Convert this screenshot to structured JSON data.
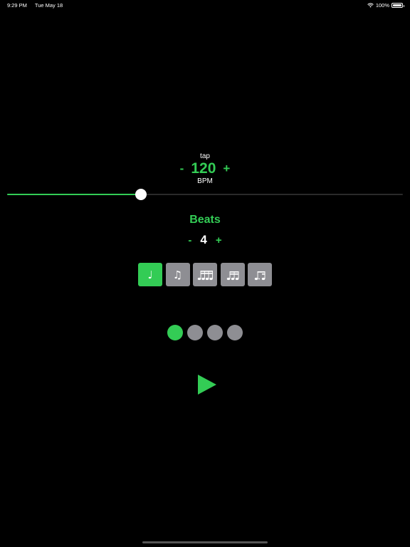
{
  "status_bar": {
    "time": "9:29 PM",
    "date": "Tue May 18",
    "battery": "100%"
  },
  "tempo": {
    "tap_label": "tap",
    "minus_label": "-",
    "plus_label": "+",
    "bpm": "120",
    "unit_label": "BPM",
    "slider_fraction": 0.338
  },
  "beats": {
    "title": "Beats",
    "minus_label": "-",
    "plus_label": "+",
    "count": "4"
  },
  "note_values": {
    "selected_index": 0,
    "items": [
      {
        "icon": "quarter-note-icon",
        "glyph": "♩"
      },
      {
        "icon": "eighth-notes-icon",
        "glyph": "♫"
      },
      {
        "icon": "sixteenth-notes-icon",
        "glyph": ""
      },
      {
        "icon": "triplet-notes-icon",
        "glyph": ""
      },
      {
        "icon": "dotted-eighth-sixteenth-icon",
        "glyph": ""
      }
    ]
  },
  "beat_dots": {
    "count": 4,
    "active_index": 0
  },
  "play": {
    "icon": "play-icon"
  },
  "colors": {
    "accent": "#33cc55",
    "inactive": "#8e8e93",
    "background": "#000000"
  }
}
